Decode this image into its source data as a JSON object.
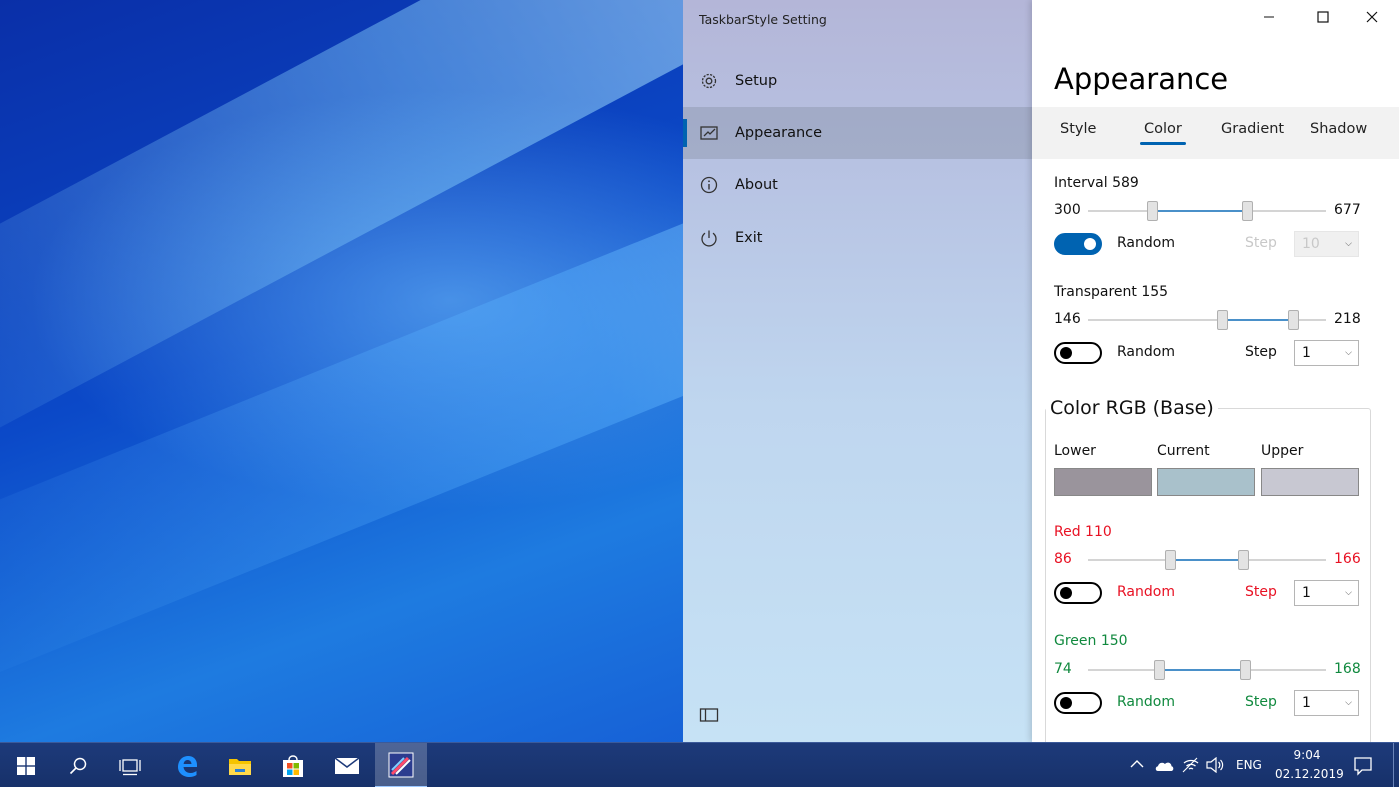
{
  "window": {
    "app_title": "TaskbarStyle Setting",
    "nav": [
      {
        "label": "Setup",
        "icon": "gear-icon"
      },
      {
        "label": "Appearance",
        "icon": "paint-icon"
      },
      {
        "label": "About",
        "icon": "info-icon"
      },
      {
        "label": "Exit",
        "icon": "power-icon"
      }
    ],
    "selected_nav": "Appearance",
    "accent_color": "#0063b1"
  },
  "content": {
    "title": "Appearance",
    "tabs": [
      "Style",
      "Color",
      "Gradient",
      "Shadow"
    ],
    "active_tab": "Color",
    "interval": {
      "label": "Interval 589",
      "min_label": "300",
      "max_label": "677",
      "lower_fraction": 0.26,
      "upper_fraction": 0.68,
      "random_label": "Random",
      "random_on": true,
      "step_label": "Step",
      "step_value": "10",
      "step_enabled": false
    },
    "transparent": {
      "label": "Transparent 155",
      "min_label": "146",
      "max_label": "218",
      "lower_fraction": 0.57,
      "upper_fraction": 0.88,
      "random_label": "Random",
      "random_on": false,
      "step_label": "Step",
      "step_value": "1"
    },
    "color_rgb": {
      "group_title": "Color RGB (Base)",
      "swatch_labels": [
        "Lower",
        "Current",
        "Upper"
      ],
      "swatch_colors": [
        "#9a949c",
        "#a9c1cb",
        "#c8c8d2"
      ],
      "red": {
        "label": "Red 110",
        "min_label": "86",
        "max_label": "166",
        "lower_fraction": 0.34,
        "upper_fraction": 0.66,
        "random_label": "Random",
        "random_on": false,
        "step_label": "Step",
        "step_value": "1",
        "color": "#e81123"
      },
      "green": {
        "label": "Green 150",
        "min_label": "74",
        "max_label": "168",
        "lower_fraction": 0.29,
        "upper_fraction": 0.67,
        "random_label": "Random",
        "random_on": false,
        "step_label": "Step",
        "step_value": "1",
        "color": "#10893e"
      }
    }
  },
  "taskbar": {
    "pinned": [
      "windows-start-icon",
      "search-icon",
      "task-view-icon",
      "edge-icon",
      "file-explorer-icon",
      "store-icon",
      "mail-icon",
      "taskbarstyle-app-icon"
    ],
    "language": "ENG",
    "time": "9:04",
    "date": "02.12.2019"
  }
}
